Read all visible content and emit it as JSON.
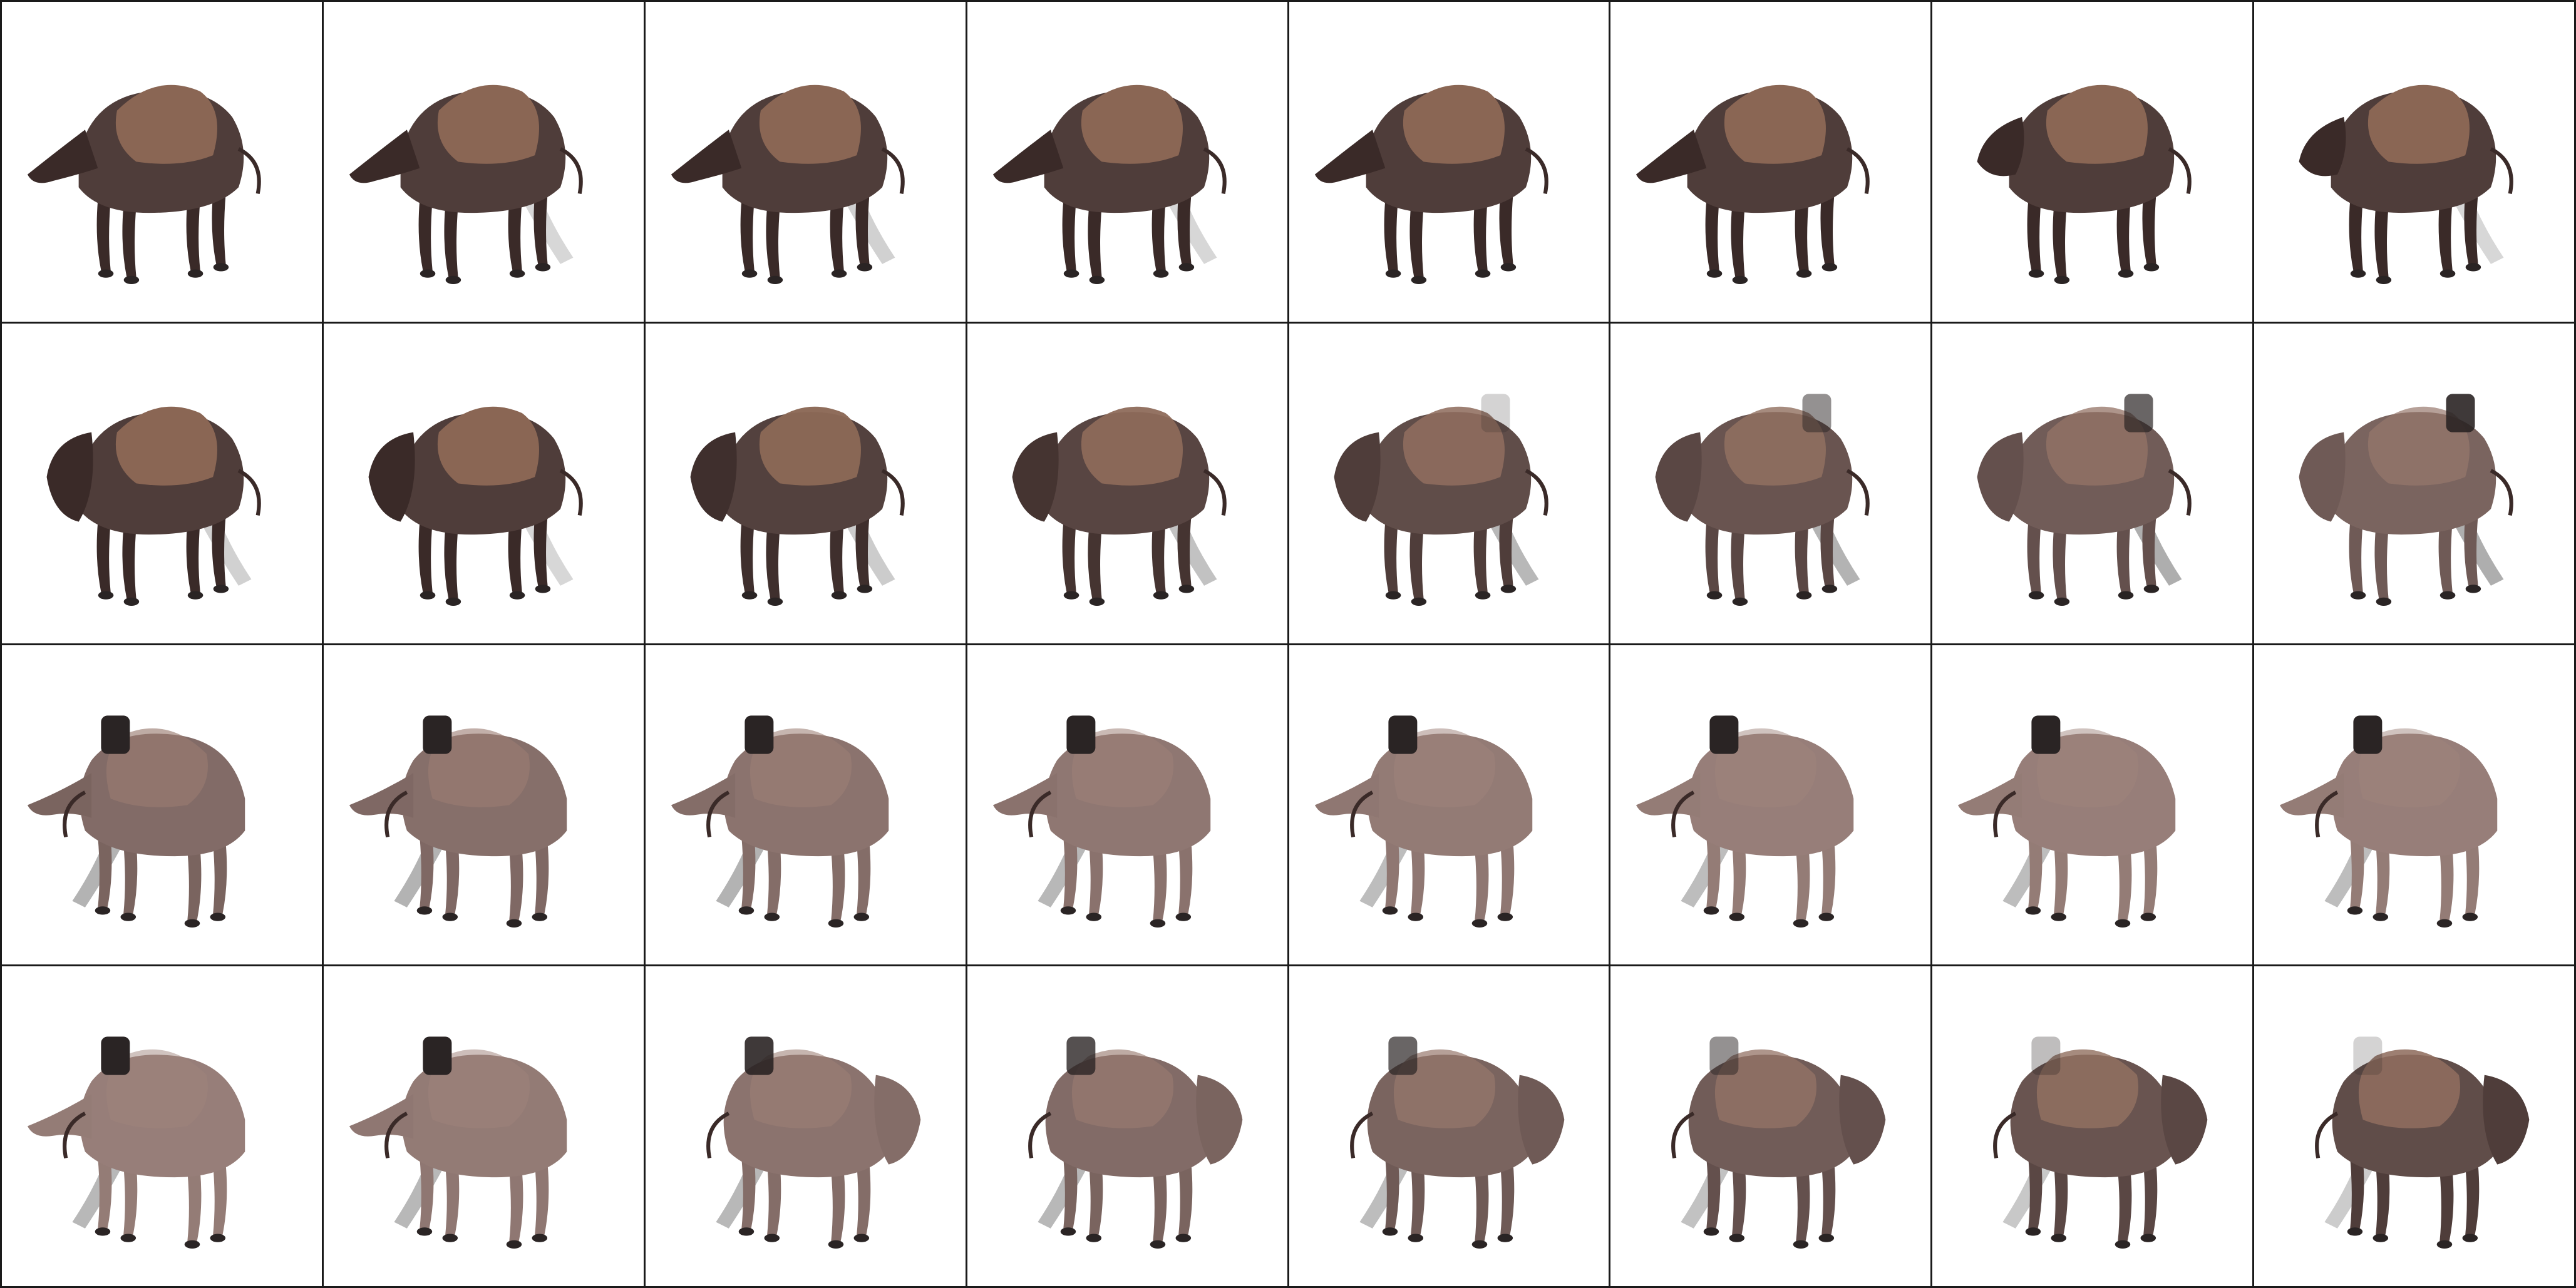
{
  "grid": {
    "rows": 4,
    "columns": 8,
    "frame_count": 32,
    "background": "#ffffff",
    "border_color": "#1a1a1a",
    "subject": "bison-render",
    "colors": {
      "fur_light": "#8a6654",
      "fur_dark": "#3a2a28",
      "skin_pink": "#a48a84",
      "hoof": "#2a2424",
      "shadow_leg": "#9a9a9a"
    },
    "frames": [
      {
        "row": 0,
        "col": 0,
        "facing": "left",
        "head_style": "elongated",
        "fur": 1.0,
        "gray_leg": 0.0,
        "block_ear": 0.0
      },
      {
        "row": 0,
        "col": 1,
        "facing": "left",
        "head_style": "elongated",
        "fur": 1.0,
        "gray_leg": 0.2,
        "block_ear": 0.0
      },
      {
        "row": 0,
        "col": 2,
        "facing": "left",
        "head_style": "elongated",
        "fur": 1.0,
        "gray_leg": 0.3,
        "block_ear": 0.0
      },
      {
        "row": 0,
        "col": 3,
        "facing": "left",
        "head_style": "elongated",
        "fur": 1.0,
        "gray_leg": 0.2,
        "block_ear": 0.0
      },
      {
        "row": 0,
        "col": 4,
        "facing": "left",
        "head_style": "elongated",
        "fur": 1.0,
        "gray_leg": 0.0,
        "block_ear": 0.0
      },
      {
        "row": 0,
        "col": 5,
        "facing": "left",
        "head_style": "elongated",
        "fur": 1.0,
        "gray_leg": 0.0,
        "block_ear": 0.0
      },
      {
        "row": 0,
        "col": 6,
        "facing": "left",
        "head_style": "round",
        "fur": 1.0,
        "gray_leg": 0.0,
        "block_ear": 0.0
      },
      {
        "row": 0,
        "col": 7,
        "facing": "left",
        "head_style": "round",
        "fur": 1.0,
        "gray_leg": 0.2,
        "block_ear": 0.0
      },
      {
        "row": 1,
        "col": 0,
        "facing": "left",
        "head_style": "bison",
        "fur": 1.0,
        "gray_leg": 0.3,
        "block_ear": 0.0
      },
      {
        "row": 1,
        "col": 1,
        "facing": "left",
        "head_style": "bison",
        "fur": 1.0,
        "gray_leg": 0.2,
        "block_ear": 0.0
      },
      {
        "row": 1,
        "col": 2,
        "facing": "left",
        "head_style": "bison",
        "fur": 0.95,
        "gray_leg": 0.4,
        "block_ear": 0.0
      },
      {
        "row": 1,
        "col": 3,
        "facing": "left",
        "head_style": "bison",
        "fur": 0.9,
        "gray_leg": 0.6,
        "block_ear": 0.0
      },
      {
        "row": 1,
        "col": 4,
        "facing": "left",
        "head_style": "bison",
        "fur": 0.8,
        "gray_leg": 0.8,
        "block_ear": 0.2
      },
      {
        "row": 1,
        "col": 5,
        "facing": "left",
        "head_style": "bison",
        "fur": 0.7,
        "gray_leg": 0.9,
        "block_ear": 0.5
      },
      {
        "row": 1,
        "col": 6,
        "facing": "left",
        "head_style": "bison",
        "fur": 0.6,
        "gray_leg": 1.0,
        "block_ear": 0.7
      },
      {
        "row": 1,
        "col": 7,
        "facing": "left",
        "head_style": "bison",
        "fur": 0.5,
        "gray_leg": 1.0,
        "block_ear": 0.9
      },
      {
        "row": 2,
        "col": 0,
        "facing": "right",
        "head_style": "snout",
        "fur": 0.4,
        "gray_leg": 0.9,
        "block_ear": 1.0
      },
      {
        "row": 2,
        "col": 1,
        "facing": "right",
        "head_style": "snout",
        "fur": 0.35,
        "gray_leg": 0.9,
        "block_ear": 1.0
      },
      {
        "row": 2,
        "col": 2,
        "facing": "right",
        "head_style": "snout",
        "fur": 0.3,
        "gray_leg": 0.9,
        "block_ear": 1.0
      },
      {
        "row": 2,
        "col": 3,
        "facing": "right",
        "head_style": "snout",
        "fur": 0.25,
        "gray_leg": 0.8,
        "block_ear": 1.0
      },
      {
        "row": 2,
        "col": 4,
        "facing": "right",
        "head_style": "snout",
        "fur": 0.2,
        "gray_leg": 0.7,
        "block_ear": 1.0
      },
      {
        "row": 2,
        "col": 5,
        "facing": "right",
        "head_style": "snout",
        "fur": 0.15,
        "gray_leg": 0.7,
        "block_ear": 1.0
      },
      {
        "row": 2,
        "col": 6,
        "facing": "right",
        "head_style": "snout",
        "fur": 0.15,
        "gray_leg": 0.7,
        "block_ear": 1.0
      },
      {
        "row": 2,
        "col": 7,
        "facing": "right",
        "head_style": "snout",
        "fur": 0.15,
        "gray_leg": 0.7,
        "block_ear": 1.0
      },
      {
        "row": 3,
        "col": 0,
        "facing": "right",
        "head_style": "snout",
        "fur": 0.15,
        "gray_leg": 0.8,
        "block_ear": 1.0
      },
      {
        "row": 3,
        "col": 1,
        "facing": "right",
        "head_style": "snout",
        "fur": 0.2,
        "gray_leg": 0.8,
        "block_ear": 1.0
      },
      {
        "row": 3,
        "col": 2,
        "facing": "right",
        "head_style": "bison",
        "fur": 0.3,
        "gray_leg": 0.8,
        "block_ear": 0.9
      },
      {
        "row": 3,
        "col": 3,
        "facing": "right",
        "head_style": "bison",
        "fur": 0.4,
        "gray_leg": 0.8,
        "block_ear": 0.8
      },
      {
        "row": 3,
        "col": 4,
        "facing": "right",
        "head_style": "bison",
        "fur": 0.5,
        "gray_leg": 0.7,
        "block_ear": 0.7
      },
      {
        "row": 3,
        "col": 5,
        "facing": "right",
        "head_style": "bison",
        "fur": 0.6,
        "gray_leg": 0.6,
        "block_ear": 0.5
      },
      {
        "row": 3,
        "col": 6,
        "facing": "right",
        "head_style": "bison",
        "fur": 0.7,
        "gray_leg": 0.5,
        "block_ear": 0.3
      },
      {
        "row": 3,
        "col": 7,
        "facing": "right",
        "head_style": "bison",
        "fur": 0.8,
        "gray_leg": 0.4,
        "block_ear": 0.2
      }
    ]
  }
}
